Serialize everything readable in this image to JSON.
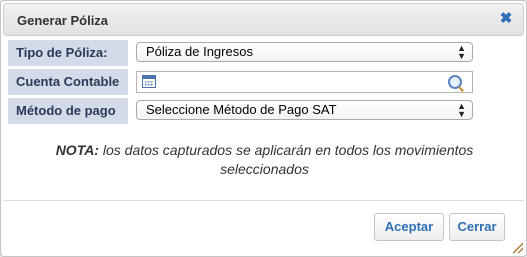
{
  "dialog": {
    "title": "Generar Póliza",
    "close_icon": "close-icon"
  },
  "form": {
    "tipo_poliza": {
      "label": "Tipo de Póliza:",
      "value": "Póliza de Ingresos"
    },
    "cuenta_contable": {
      "label": "Cuenta Contable",
      "value": "",
      "left_icon": "calendar-icon",
      "right_icon": "search-icon"
    },
    "metodo_pago": {
      "label": "Método de pago",
      "value": "Seleccione Método de Pago SAT"
    }
  },
  "note": {
    "lead": "NOTA:",
    "text": " los datos capturados se aplicarán en todos los movimientos",
    "text2": "seleccionados"
  },
  "footer": {
    "accept_label": "Aceptar",
    "cancel_label": "Cerrar"
  },
  "colors": {
    "label_bg": "#d3dbe9",
    "accent": "#2f6fb5"
  }
}
